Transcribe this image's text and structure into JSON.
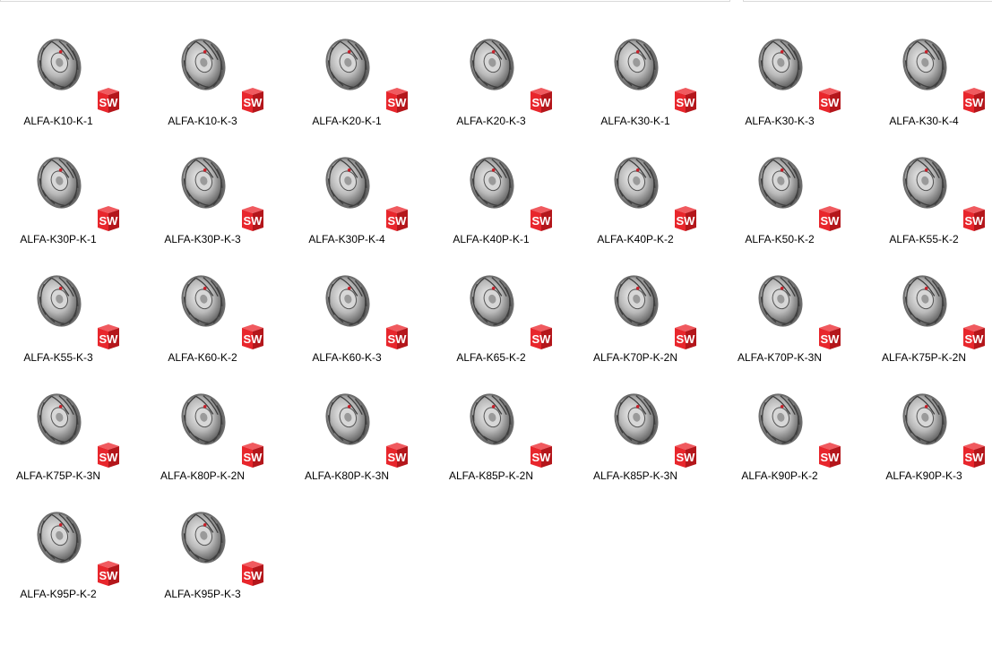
{
  "files": [
    {
      "name": "ALFA-K10-K-1"
    },
    {
      "name": "ALFA-K10-K-3"
    },
    {
      "name": "ALFA-K20-K-1"
    },
    {
      "name": "ALFA-K20-K-3"
    },
    {
      "name": "ALFA-K30-K-1"
    },
    {
      "name": "ALFA-K30-K-3"
    },
    {
      "name": "ALFA-K30-K-4"
    },
    {
      "name": "ALFA-K30P-K-1"
    },
    {
      "name": "ALFA-K30P-K-3"
    },
    {
      "name": "ALFA-K30P-K-4"
    },
    {
      "name": "ALFA-K40P-K-1"
    },
    {
      "name": "ALFA-K40P-K-2"
    },
    {
      "name": "ALFA-K50-K-2"
    },
    {
      "name": "ALFA-K55-K-2"
    },
    {
      "name": "ALFA-K55-K-3"
    },
    {
      "name": "ALFA-K60-K-2"
    },
    {
      "name": "ALFA-K60-K-3"
    },
    {
      "name": "ALFA-K65-K-2"
    },
    {
      "name": "ALFA-K70P-K-2N"
    },
    {
      "name": "ALFA-K70P-K-3N"
    },
    {
      "name": "ALFA-K75P-K-2N"
    },
    {
      "name": "ALFA-K75P-K-3N"
    },
    {
      "name": "ALFA-K80P-K-2N"
    },
    {
      "name": "ALFA-K80P-K-3N"
    },
    {
      "name": "ALFA-K85P-K-2N"
    },
    {
      "name": "ALFA-K85P-K-3N"
    },
    {
      "name": "ALFA-K90P-K-2"
    },
    {
      "name": "ALFA-K90P-K-3"
    },
    {
      "name": "ALFA-K95P-K-2"
    },
    {
      "name": "ALFA-K95P-K-3"
    }
  ],
  "badge": {
    "text": "SW",
    "color": "#e8262c",
    "dark_color": "#b4161b"
  },
  "icons": {
    "thumbnail": "fan-impeller-icon",
    "badge": "solidworks-badge-icon"
  }
}
